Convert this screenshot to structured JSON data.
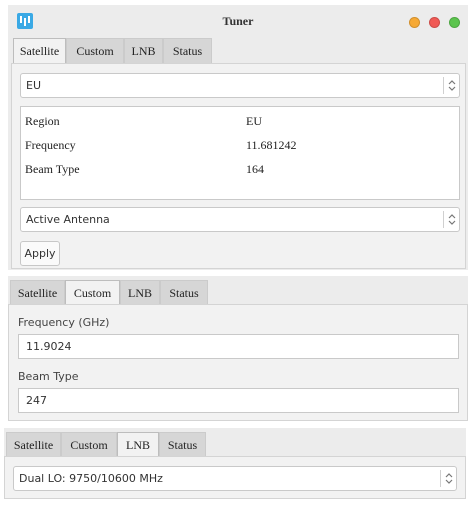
{
  "window": {
    "title": "Tuner",
    "traffic_light_colors": [
      "#f6a935",
      "#f05a55",
      "#5bc44d"
    ]
  },
  "tabs": [
    "Satellite",
    "Custom",
    "LNB",
    "Status"
  ],
  "satellite": {
    "region_select": "EU",
    "info": {
      "region_label": "Region",
      "region_value": "EU",
      "frequency_label": "Frequency",
      "frequency_value": "11.681242",
      "beam_type_label": "Beam Type",
      "beam_type_value": "164"
    },
    "antenna_select": "Active Antenna",
    "apply_label": "Apply"
  },
  "custom": {
    "frequency_label": "Frequency (GHz)",
    "frequency_value": "11.9024",
    "beam_type_label": "Beam Type",
    "beam_type_value": "247"
  },
  "lnb": {
    "lo_select": "Dual LO: 9750/10600 MHz"
  },
  "colors": {
    "app_icon": "#3aa9e5",
    "panel": "#ececec",
    "tab_active": "#f2f2f2",
    "tab_inactive": "#d6d6d6"
  }
}
